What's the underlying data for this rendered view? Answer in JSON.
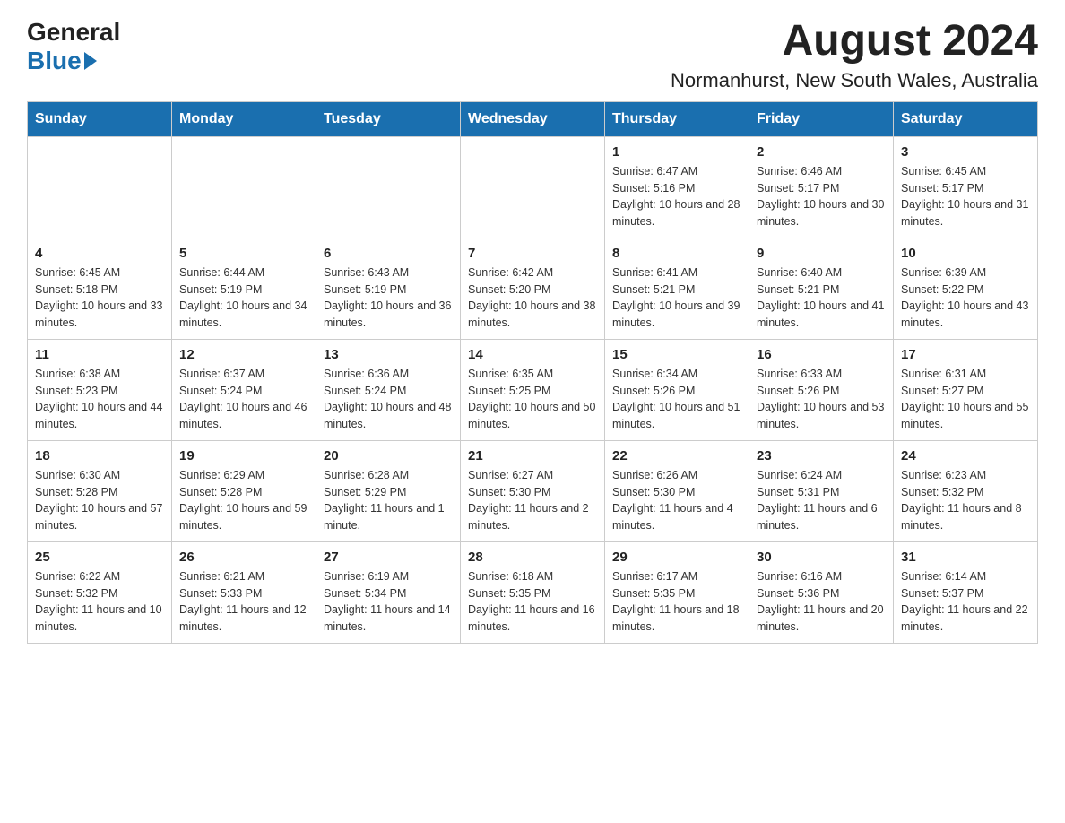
{
  "logo": {
    "general": "General",
    "blue": "Blue"
  },
  "title": {
    "month_year": "August 2024",
    "location": "Normanhurst, New South Wales, Australia"
  },
  "headers": [
    "Sunday",
    "Monday",
    "Tuesday",
    "Wednesday",
    "Thursday",
    "Friday",
    "Saturday"
  ],
  "weeks": [
    [
      {
        "day": "",
        "info": ""
      },
      {
        "day": "",
        "info": ""
      },
      {
        "day": "",
        "info": ""
      },
      {
        "day": "",
        "info": ""
      },
      {
        "day": "1",
        "info": "Sunrise: 6:47 AM\nSunset: 5:16 PM\nDaylight: 10 hours and 28 minutes."
      },
      {
        "day": "2",
        "info": "Sunrise: 6:46 AM\nSunset: 5:17 PM\nDaylight: 10 hours and 30 minutes."
      },
      {
        "day": "3",
        "info": "Sunrise: 6:45 AM\nSunset: 5:17 PM\nDaylight: 10 hours and 31 minutes."
      }
    ],
    [
      {
        "day": "4",
        "info": "Sunrise: 6:45 AM\nSunset: 5:18 PM\nDaylight: 10 hours and 33 minutes."
      },
      {
        "day": "5",
        "info": "Sunrise: 6:44 AM\nSunset: 5:19 PM\nDaylight: 10 hours and 34 minutes."
      },
      {
        "day": "6",
        "info": "Sunrise: 6:43 AM\nSunset: 5:19 PM\nDaylight: 10 hours and 36 minutes."
      },
      {
        "day": "7",
        "info": "Sunrise: 6:42 AM\nSunset: 5:20 PM\nDaylight: 10 hours and 38 minutes."
      },
      {
        "day": "8",
        "info": "Sunrise: 6:41 AM\nSunset: 5:21 PM\nDaylight: 10 hours and 39 minutes."
      },
      {
        "day": "9",
        "info": "Sunrise: 6:40 AM\nSunset: 5:21 PM\nDaylight: 10 hours and 41 minutes."
      },
      {
        "day": "10",
        "info": "Sunrise: 6:39 AM\nSunset: 5:22 PM\nDaylight: 10 hours and 43 minutes."
      }
    ],
    [
      {
        "day": "11",
        "info": "Sunrise: 6:38 AM\nSunset: 5:23 PM\nDaylight: 10 hours and 44 minutes."
      },
      {
        "day": "12",
        "info": "Sunrise: 6:37 AM\nSunset: 5:24 PM\nDaylight: 10 hours and 46 minutes."
      },
      {
        "day": "13",
        "info": "Sunrise: 6:36 AM\nSunset: 5:24 PM\nDaylight: 10 hours and 48 minutes."
      },
      {
        "day": "14",
        "info": "Sunrise: 6:35 AM\nSunset: 5:25 PM\nDaylight: 10 hours and 50 minutes."
      },
      {
        "day": "15",
        "info": "Sunrise: 6:34 AM\nSunset: 5:26 PM\nDaylight: 10 hours and 51 minutes."
      },
      {
        "day": "16",
        "info": "Sunrise: 6:33 AM\nSunset: 5:26 PM\nDaylight: 10 hours and 53 minutes."
      },
      {
        "day": "17",
        "info": "Sunrise: 6:31 AM\nSunset: 5:27 PM\nDaylight: 10 hours and 55 minutes."
      }
    ],
    [
      {
        "day": "18",
        "info": "Sunrise: 6:30 AM\nSunset: 5:28 PM\nDaylight: 10 hours and 57 minutes."
      },
      {
        "day": "19",
        "info": "Sunrise: 6:29 AM\nSunset: 5:28 PM\nDaylight: 10 hours and 59 minutes."
      },
      {
        "day": "20",
        "info": "Sunrise: 6:28 AM\nSunset: 5:29 PM\nDaylight: 11 hours and 1 minute."
      },
      {
        "day": "21",
        "info": "Sunrise: 6:27 AM\nSunset: 5:30 PM\nDaylight: 11 hours and 2 minutes."
      },
      {
        "day": "22",
        "info": "Sunrise: 6:26 AM\nSunset: 5:30 PM\nDaylight: 11 hours and 4 minutes."
      },
      {
        "day": "23",
        "info": "Sunrise: 6:24 AM\nSunset: 5:31 PM\nDaylight: 11 hours and 6 minutes."
      },
      {
        "day": "24",
        "info": "Sunrise: 6:23 AM\nSunset: 5:32 PM\nDaylight: 11 hours and 8 minutes."
      }
    ],
    [
      {
        "day": "25",
        "info": "Sunrise: 6:22 AM\nSunset: 5:32 PM\nDaylight: 11 hours and 10 minutes."
      },
      {
        "day": "26",
        "info": "Sunrise: 6:21 AM\nSunset: 5:33 PM\nDaylight: 11 hours and 12 minutes."
      },
      {
        "day": "27",
        "info": "Sunrise: 6:19 AM\nSunset: 5:34 PM\nDaylight: 11 hours and 14 minutes."
      },
      {
        "day": "28",
        "info": "Sunrise: 6:18 AM\nSunset: 5:35 PM\nDaylight: 11 hours and 16 minutes."
      },
      {
        "day": "29",
        "info": "Sunrise: 6:17 AM\nSunset: 5:35 PM\nDaylight: 11 hours and 18 minutes."
      },
      {
        "day": "30",
        "info": "Sunrise: 6:16 AM\nSunset: 5:36 PM\nDaylight: 11 hours and 20 minutes."
      },
      {
        "day": "31",
        "info": "Sunrise: 6:14 AM\nSunset: 5:37 PM\nDaylight: 11 hours and 22 minutes."
      }
    ]
  ]
}
